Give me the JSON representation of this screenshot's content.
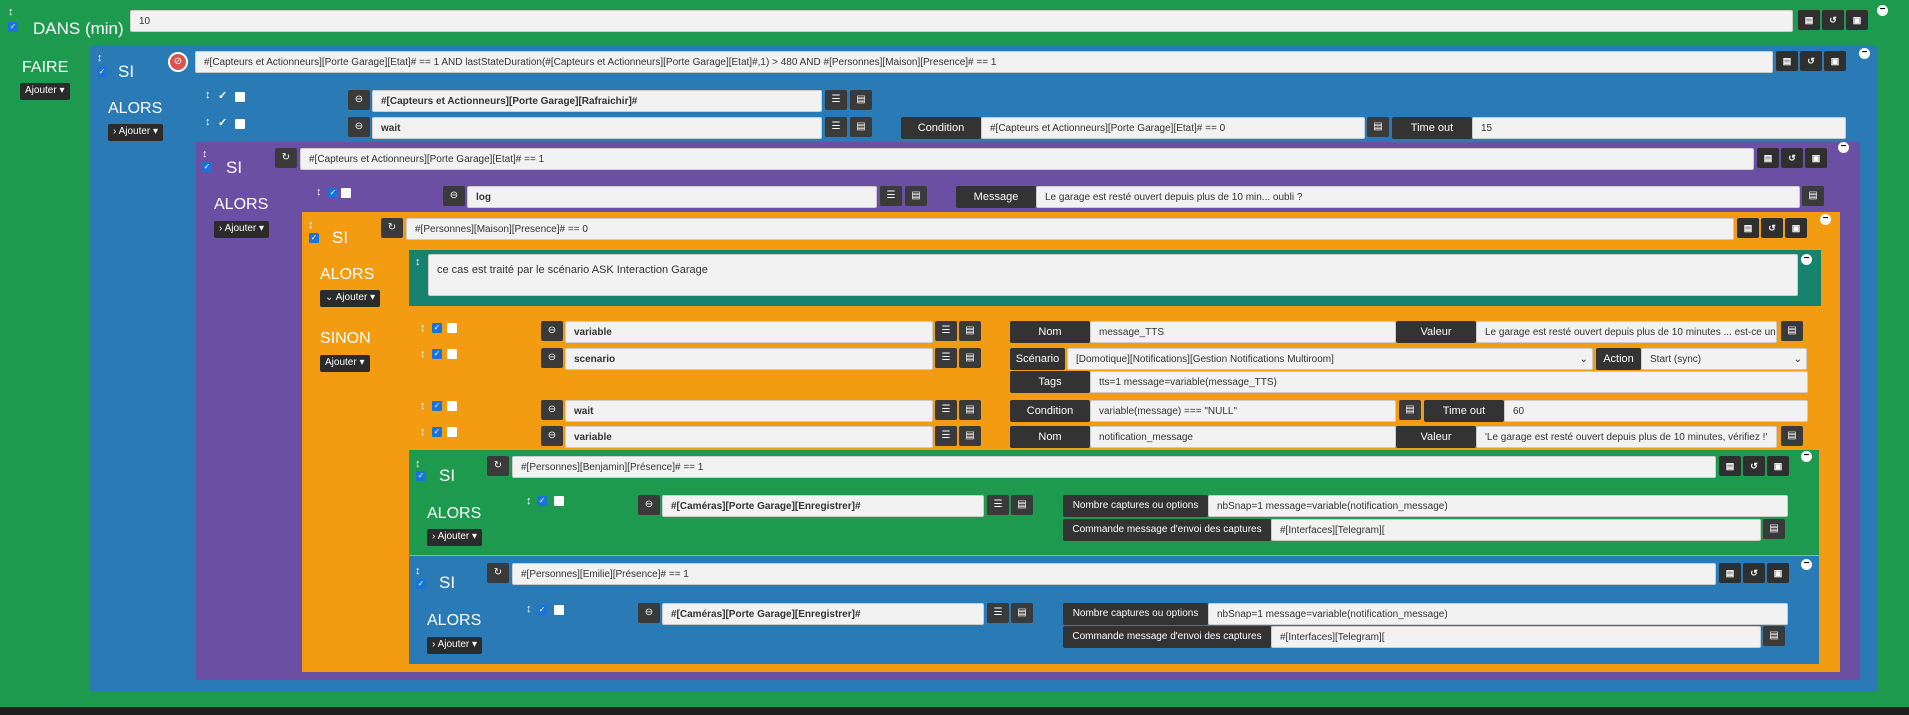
{
  "root": {
    "title": "DANS (min)",
    "value": "10",
    "faire": "FAIRE",
    "ajouter": "Ajouter"
  },
  "si1": {
    "label": "SI",
    "condition": "#[Capteurs et Actionneurs][Porte Garage][Etat]# == 1 AND lastStateDuration(#[Capteurs et Actionneurs][Porte Garage][Etat]#,1) > 480 AND #[Personnes][Maison][Presence]# == 1",
    "alors": "ALORS",
    "ajouter": "Ajouter"
  },
  "a1": {
    "cmd": "#[Capteurs et Actionneurs][Porte Garage][Rafraichir]#"
  },
  "a2": {
    "cmd": "wait",
    "cond_label": "Condition",
    "cond_value": "#[Capteurs et Actionneurs][Porte Garage][Etat]# == 0",
    "timeout_label": "Time out",
    "timeout_value": "15"
  },
  "si2": {
    "label": "SI",
    "condition": "#[Capteurs et Actionneurs][Porte Garage][Etat]# == 1",
    "alors": "ALORS",
    "ajouter": "Ajouter"
  },
  "log": {
    "cmd": "log",
    "msg_label": "Message",
    "msg_value": "Le garage est resté ouvert depuis plus de 10 min... oubli ?"
  },
  "si3": {
    "label": "SI",
    "condition": "#[Personnes][Maison][Presence]# == 0",
    "alors": "ALORS",
    "ajouter": "Ajouter",
    "comment": "ce cas est traité par le scénario ASK Interaction Garage",
    "sinon": "SINON"
  },
  "s1": {
    "cmd": "variable",
    "nom_label": "Nom",
    "nom_value": "message_TTS",
    "valeur_label": "Valeur",
    "valeur_value": "Le garage est resté ouvert depuis plus de 10 minutes ... est-ce un"
  },
  "s2": {
    "cmd": "scenario",
    "scen_label": "Scénario",
    "scen_value": "[Domotique][Notifications][Gestion Notifications Multiroom]",
    "action_label": "Action",
    "action_value": "Start (sync)",
    "tags_label": "Tags",
    "tags_value": "tts=1 message=variable(message_TTS)"
  },
  "s3": {
    "cmd": "wait",
    "cond_label": "Condition",
    "cond_value": "variable(message) === \"NULL\"",
    "timeout_label": "Time out",
    "timeout_value": "60"
  },
  "s4": {
    "cmd": "variable",
    "nom_label": "Nom",
    "nom_value": "notification_message",
    "valeur_label": "Valeur",
    "valeur_value": "'Le garage est resté ouvert depuis plus de 10 minutes, vérifiez !'"
  },
  "si4": {
    "label": "SI",
    "condition": "#[Personnes][Benjamin][Présence]# == 1",
    "alors": "ALORS",
    "ajouter": "Ajouter",
    "cmd": "#[Caméras][Porte Garage][Enregistrer]#",
    "opt_label": "Nombre captures ou options",
    "opt_value": "nbSnap=1 message=variable(notification_message)",
    "cmdmsg_label": "Commande message d'envoi des captures",
    "cmdmsg_value": "#[Interfaces][Telegram]["
  },
  "si5": {
    "label": "SI",
    "condition": "#[Personnes][Emilie][Présence]# == 1",
    "alors": "ALORS",
    "ajouter": "Ajouter",
    "cmd": "#[Caméras][Porte Garage][Enregistrer]#",
    "opt_label": "Nombre captures ou options",
    "opt_value": "nbSnap=1 message=variable(notification_message)",
    "cmdmsg_label": "Commande message d'envoi des captures",
    "cmdmsg_value": "#[Interfaces][Telegram]["
  },
  "colors": {
    "green": "#1e9a4e",
    "blue": "#2a7ab5",
    "purple": "#6b4fa3",
    "orange": "#f39c12",
    "teal": "#17826e"
  }
}
